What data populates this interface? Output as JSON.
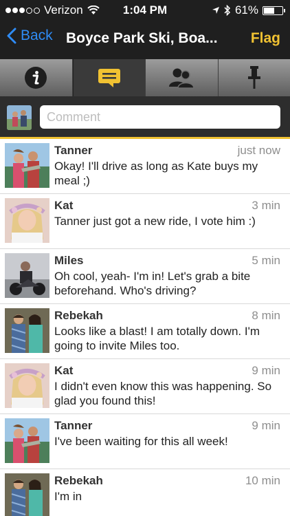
{
  "status_bar": {
    "carrier": "Verizon",
    "time": "1:04 PM",
    "battery": "61%",
    "battery_level": 0.61
  },
  "nav": {
    "back_label": "Back",
    "title": "Boyce Park Ski, Boa...",
    "flag_label": "Flag"
  },
  "tabs": [
    {
      "name": "info",
      "icon": "info-icon"
    },
    {
      "name": "comments",
      "icon": "chat-bubble-icon",
      "active": true
    },
    {
      "name": "people",
      "icon": "people-icon"
    },
    {
      "name": "location",
      "icon": "pin-icon"
    }
  ],
  "comment_box": {
    "placeholder": "Comment"
  },
  "comments": [
    {
      "name": "Tanner",
      "time": "just now",
      "text": "Okay! I'll drive as long as Kate buys my meal ;)"
    },
    {
      "name": "Kat",
      "time": "3 min",
      "text": "Tanner just got a new ride, I vote him :)"
    },
    {
      "name": "Miles",
      "time": "5 min",
      "text": "Oh cool, yeah- I'm in!  Let's grab a bite beforehand. Who's driving?"
    },
    {
      "name": "Rebekah",
      "time": "8 min",
      "text": "Looks like a blast! I am totally down.  I'm going to invite Miles too."
    },
    {
      "name": "Kat",
      "time": "9 min",
      "text": "I didn't even know this was happening. So glad you found this!"
    },
    {
      "name": "Tanner",
      "time": "9 min",
      "text": "I've been waiting for this all week!"
    },
    {
      "name": "Rebekah",
      "time": "10 min",
      "text": "I'm in"
    }
  ],
  "colors": {
    "accent": "#f1c232",
    "link": "#2f8cf6",
    "bar": "#1f1f1f"
  }
}
